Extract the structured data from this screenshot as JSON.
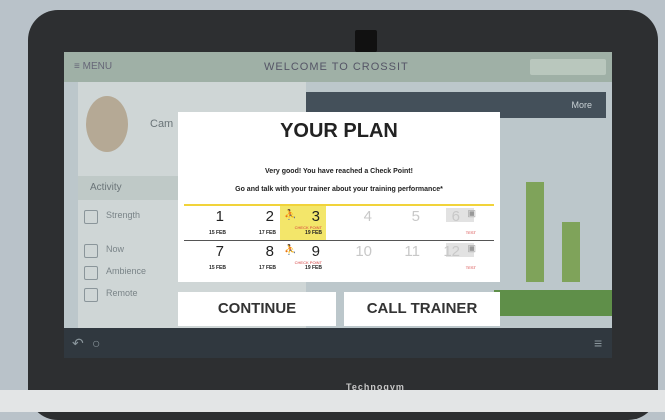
{
  "background_app": {
    "menu": "≡ MENU",
    "title": "WELCOME TO CROSSIT",
    "user_name": "Cam",
    "activity_label": "Activity",
    "list_items": [
      "Strength",
      "Now",
      "Ambience",
      "Remote"
    ],
    "right_button": "More"
  },
  "modal": {
    "title": "YOUR PLAN",
    "message1": "Very good! You have reached a Check Point!",
    "message2": "Go and talk with your trainer about your training performance*",
    "rows": [
      [
        {
          "num": "1",
          "date": "15 FEB"
        },
        {
          "num": "2",
          "date": "17 FEB"
        },
        {
          "num": "3",
          "date": "19 FEB",
          "checkpoint": "CHECK POINT"
        },
        {
          "num": "4"
        },
        {
          "num": "5"
        },
        {
          "num": "6",
          "tag": "TEST"
        }
      ],
      [
        {
          "num": "7",
          "date": "15 FEB"
        },
        {
          "num": "8",
          "date": "17 FEB"
        },
        {
          "num": "9",
          "date": "19 FEB",
          "checkpoint": "CHECK POINT"
        },
        {
          "num": "10"
        },
        {
          "num": "11"
        },
        {
          "num": "12",
          "tag": "TEST"
        }
      ]
    ]
  },
  "buttons": {
    "continue": "CONTINUE",
    "call_trainer": "CALL TRAINER"
  },
  "device": {
    "logo": "Technogym"
  }
}
